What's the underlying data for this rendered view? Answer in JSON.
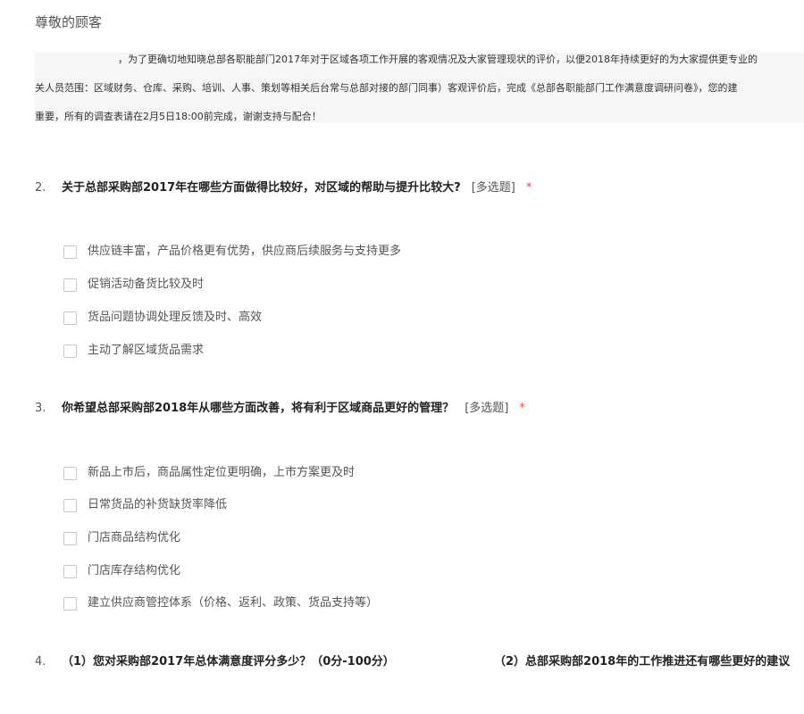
{
  "greeting": "尊敬的顾客",
  "intro": {
    "line1": "，为了更确切地知晓总部各职能部门2017年对于区域各项工作开展的客观情况及大家管理现状的评价，以便2018年持续更好的为大家提供更专业的",
    "line2": "关人员范围：区域财务、仓库、采购、培训、人事、策划等相关后台常与总部对接的部门同事）客观评价后，完成《总部各职能部门工作满意度调研问卷》，您的建",
    "line3": "重要，所有的调查表请在2月5日18:00前完成，谢谢支持与配合！"
  },
  "questions": [
    {
      "number": "2.",
      "text": "关于总部采购部2017年在哪些方面做得比较好，对区域的帮助与提升比较大?",
      "tag": "[多选题]",
      "required": "*",
      "options": [
        "供应链丰富，产品价格更有优势，供应商后续服务与支持更多",
        "促销活动备货比较及时",
        "货品问题协调处理反馈及时、高效",
        "主动了解区域货品需求"
      ]
    },
    {
      "number": "3.",
      "text": "你希望总部采购部2018年从哪些方面改善，将有利于区域商品更好的管理？",
      "tag": "[多选题]",
      "required": "*",
      "options": [
        "新品上市后，商品属性定位更明确，上市方案更及时",
        "日常货品的补货缺货率降低",
        "门店商品结构优化",
        "门店库存结构优化",
        "建立供应商管控体系（价格、返利、政策、货品支持等）"
      ]
    },
    {
      "number": "4.",
      "part1": "（1）您对采购部2017年总体满意度评分多少？（0分-100分）",
      "part2": "（2）总部采购部2018年的工作推进还有哪些更好的建议"
    }
  ]
}
